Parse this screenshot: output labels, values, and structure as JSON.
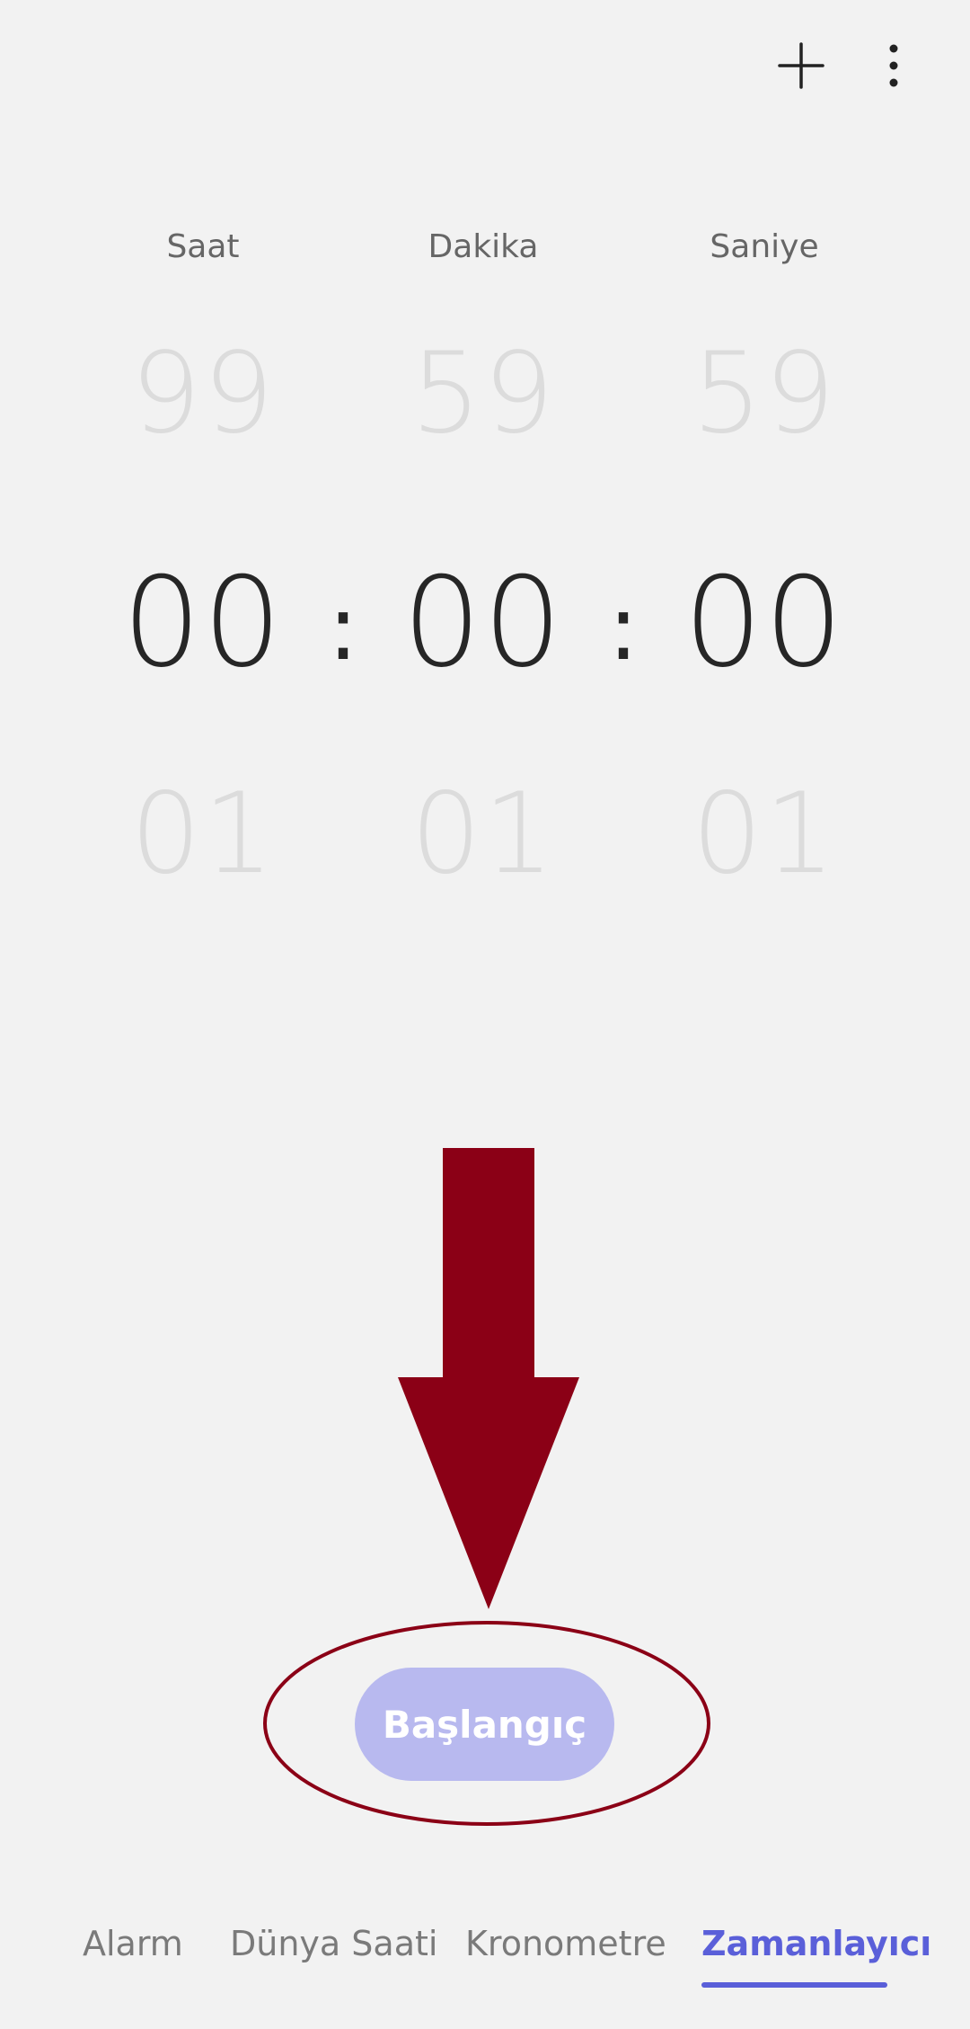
{
  "header": {
    "add_icon": "plus-icon",
    "more_icon": "more-vert-icon"
  },
  "picker": {
    "labels": {
      "hours": "Saat",
      "minutes": "Dakika",
      "seconds": "Saniye"
    },
    "previous": {
      "hours": "99",
      "minutes": "59",
      "seconds": "59"
    },
    "current": {
      "hours": "00",
      "minutes": "00",
      "seconds": "00"
    },
    "next": {
      "hours": "01",
      "minutes": "01",
      "seconds": "01"
    },
    "separator": ":"
  },
  "start_button": {
    "label": "Başlangıç",
    "color": "#b8b9ef"
  },
  "annotation": {
    "arrow_color": "#8b0016",
    "ellipse_color": "#8b0016"
  },
  "tabs": {
    "alarm": "Alarm",
    "world_clock": "Dünya Saati",
    "stopwatch": "Kronometre",
    "timer": "Zamanlayıcı",
    "active": "Zamanlayıcı",
    "active_color": "#5a5fd9"
  }
}
